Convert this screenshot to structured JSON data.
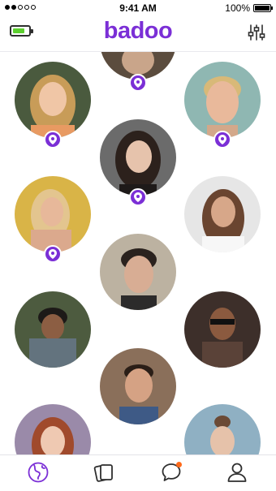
{
  "status_bar": {
    "time": "9:41 AM",
    "battery_percent": "100%",
    "signal_bars_filled": 2,
    "signal_bars_total": 5
  },
  "header": {
    "logo": "badoo",
    "left_icon": "battery-charging-icon",
    "right_icon": "filter-sliders-icon"
  },
  "colors": {
    "brand": "#7b2fd6",
    "charge": "#5ccf2f"
  },
  "profiles": [
    {
      "id": "top-partial",
      "has_location_pin": true
    },
    {
      "id": "woman-blonde",
      "has_location_pin": true
    },
    {
      "id": "man-blond",
      "has_location_pin": true
    },
    {
      "id": "woman-dark-hair",
      "has_location_pin": true
    },
    {
      "id": "woman-blonde-sitting",
      "has_location_pin": true
    },
    {
      "id": "woman-brunette",
      "has_location_pin": false
    },
    {
      "id": "man-undercut",
      "has_location_pin": false
    },
    {
      "id": "man-curly",
      "has_location_pin": false
    },
    {
      "id": "man-sunglasses",
      "has_location_pin": false
    },
    {
      "id": "man-smiling",
      "has_location_pin": false
    },
    {
      "id": "woman-redhead",
      "has_location_pin": false
    },
    {
      "id": "woman-bun",
      "has_location_pin": false
    }
  ],
  "tabs": [
    {
      "id": "tab-people-nearby",
      "icon": "globe-icon",
      "active": true
    },
    {
      "id": "tab-encounters",
      "icon": "cards-icon",
      "active": false
    },
    {
      "id": "tab-messages",
      "icon": "chat-bubble-icon",
      "active": false,
      "has_notification_dot": true
    },
    {
      "id": "tab-profile",
      "icon": "person-icon",
      "active": false
    }
  ]
}
